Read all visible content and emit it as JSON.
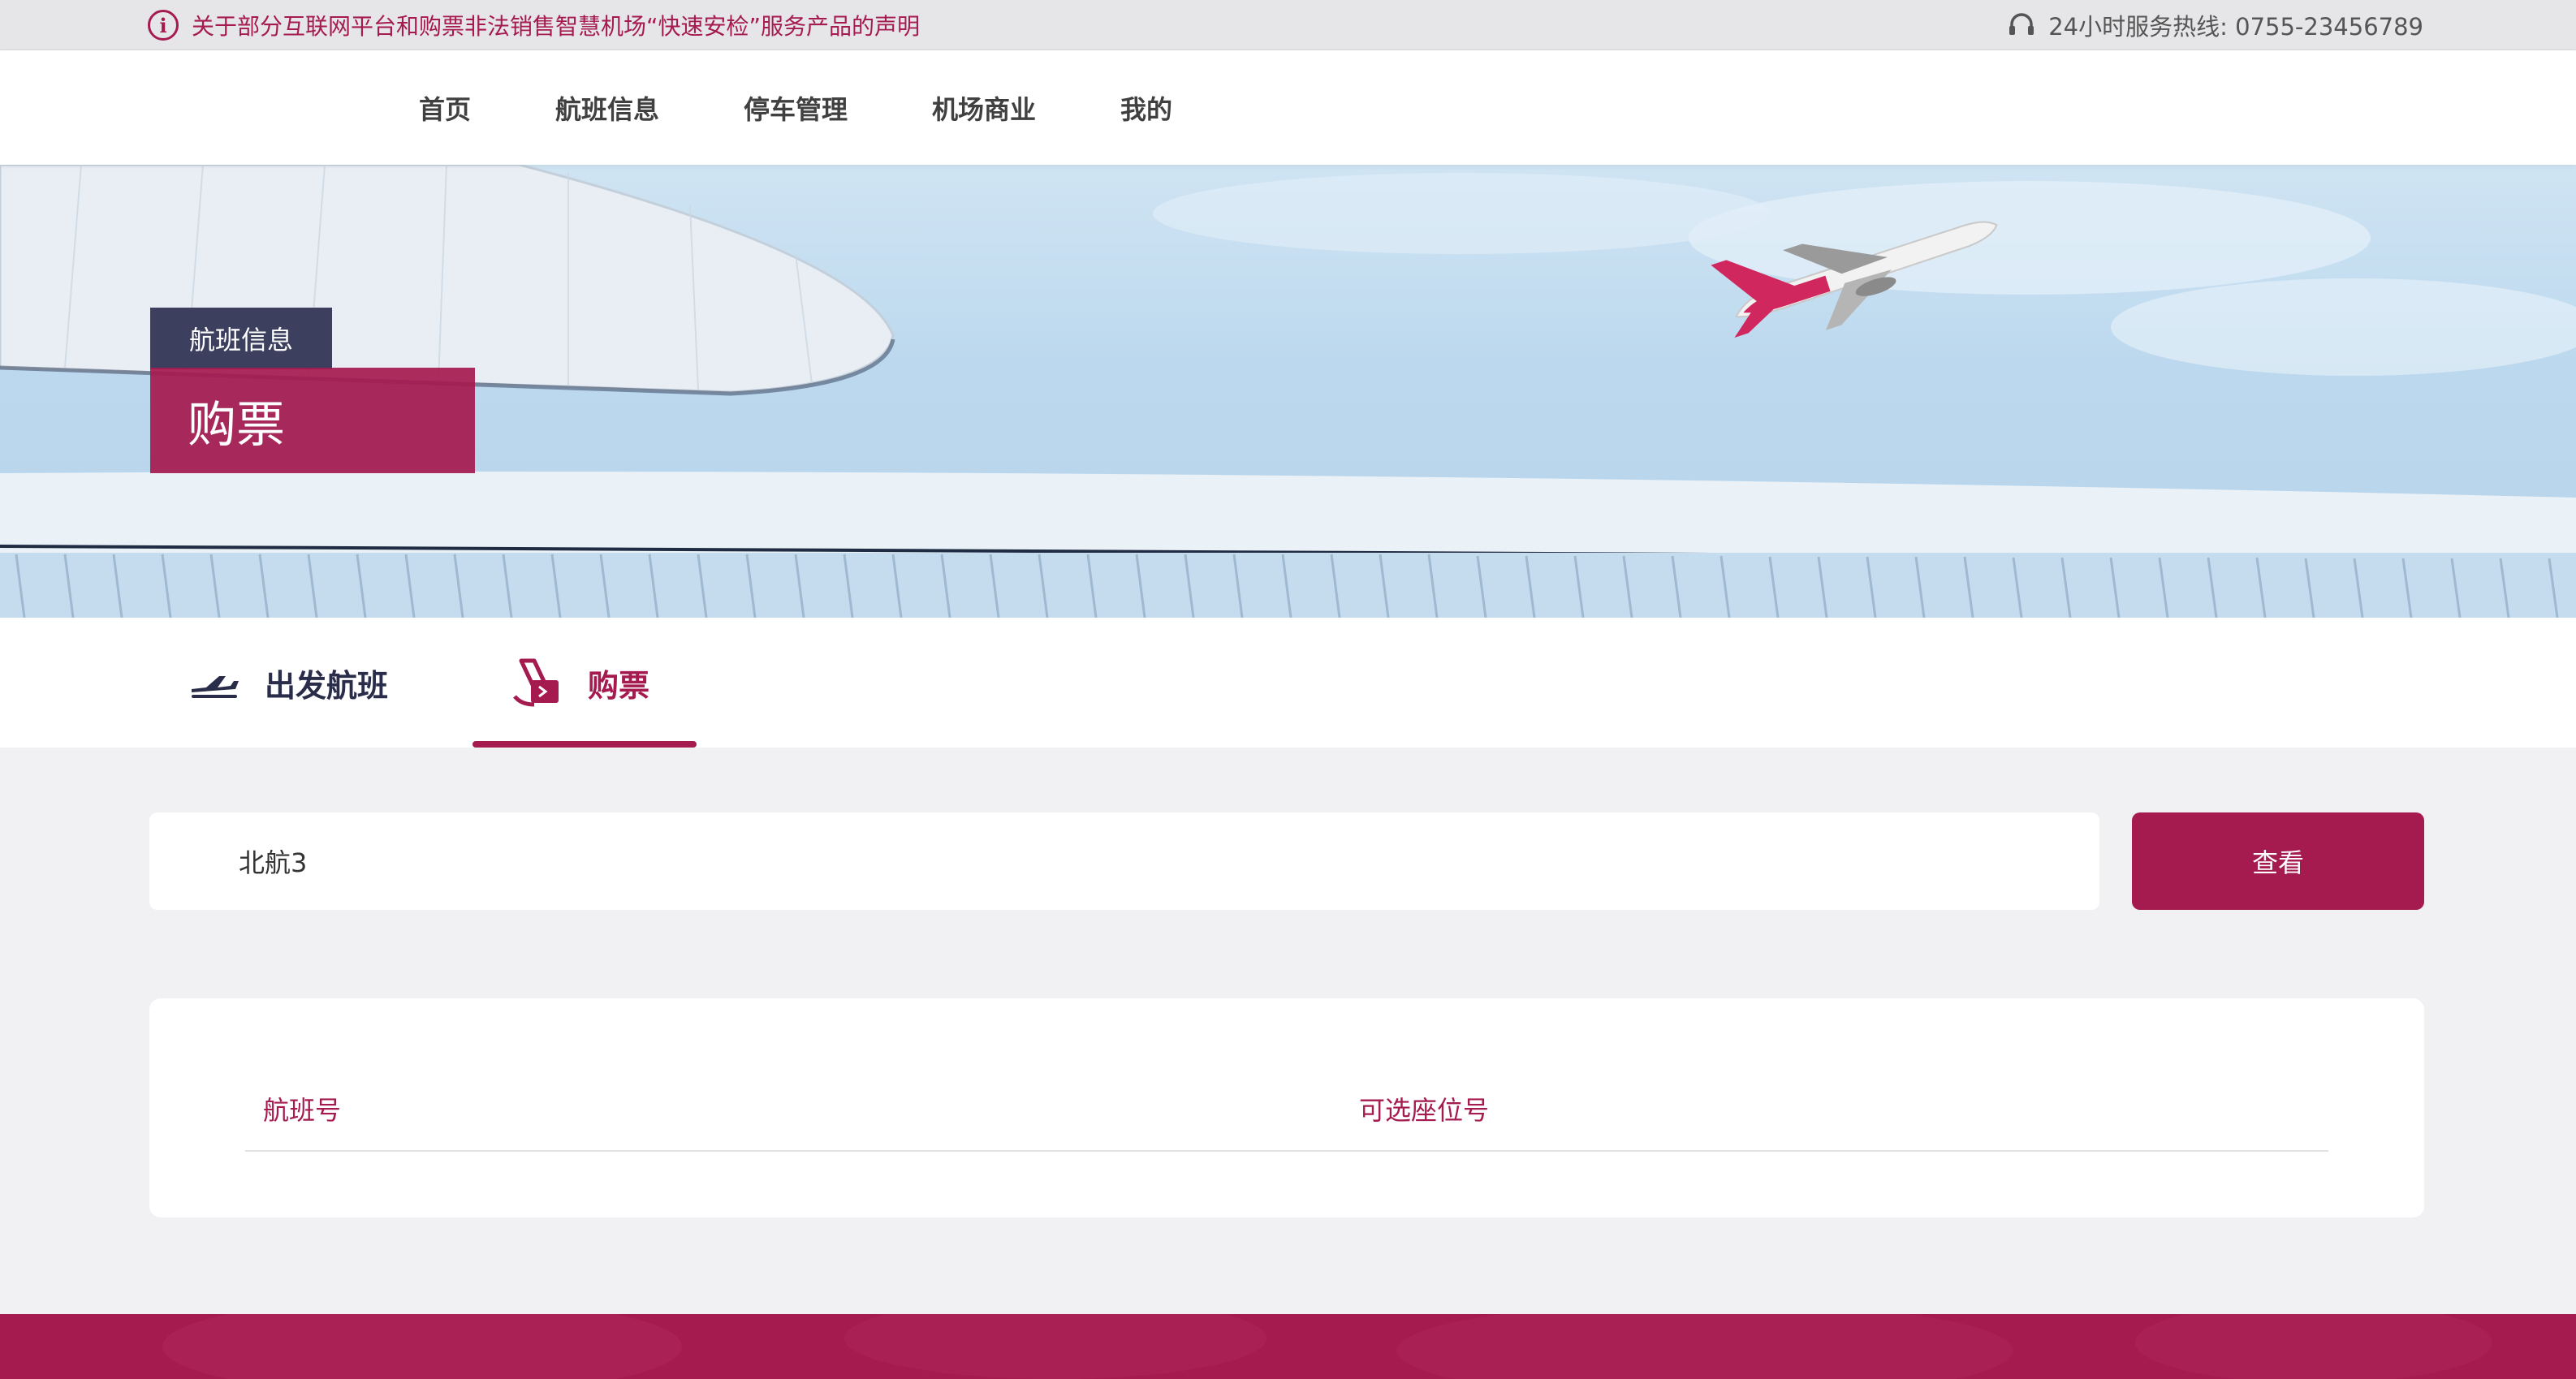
{
  "topbar": {
    "notice_text": "关于部分互联网平台和购票非法销售智慧机场“快速安检”服务产品的声明",
    "notice_icon": "info-circle-icon",
    "hotline_icon": "headset-icon",
    "hotline_text": "24小时服务热线:   0755-23456789"
  },
  "nav": {
    "items": [
      {
        "label": "首页"
      },
      {
        "label": "航班信息"
      },
      {
        "label": "停车管理"
      },
      {
        "label": "机场商业"
      },
      {
        "label": "我的"
      }
    ]
  },
  "banner": {
    "small_label": "航班信息",
    "big_label": "购票"
  },
  "tabs": [
    {
      "label": "出发航班",
      "icon": "airplane-takeoff-icon",
      "active": false
    },
    {
      "label": "购票",
      "icon": "ticket-icon",
      "active": true
    }
  ],
  "search": {
    "value": "北航3",
    "placeholder": "",
    "button_label": "查看"
  },
  "table": {
    "columns": [
      "航班号",
      "可选座位号"
    ],
    "rows": []
  },
  "colors": {
    "accent": "#a51a4f",
    "navy": "#2a2d4a",
    "background": "#f1f1f3"
  }
}
